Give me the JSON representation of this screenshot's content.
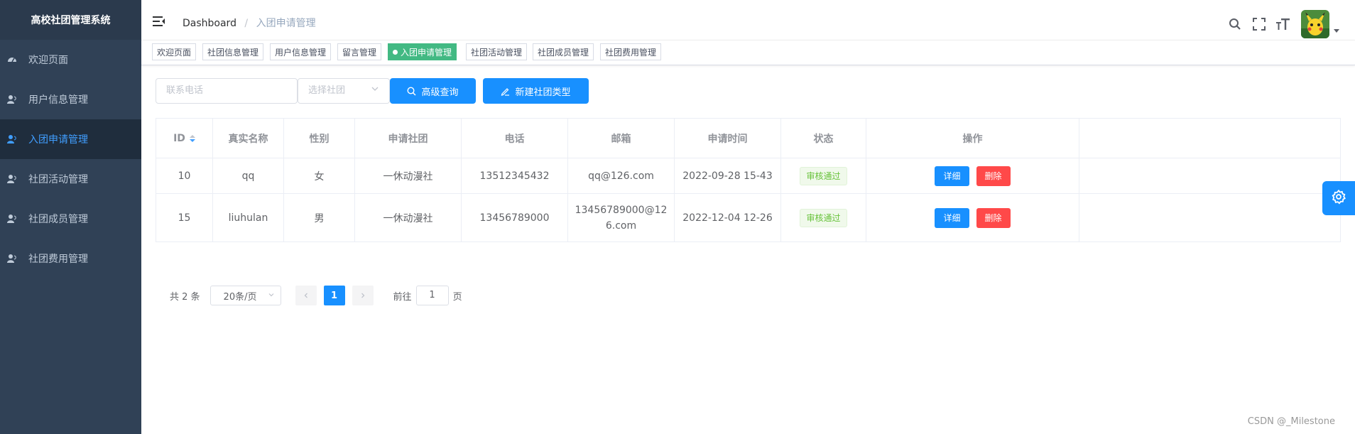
{
  "app": {
    "title": "高校社团管理系统"
  },
  "sidebar": {
    "items": [
      {
        "label": "欢迎页面",
        "icon": "dashboard-icon"
      },
      {
        "label": "用户信息管理",
        "icon": "user-icon"
      },
      {
        "label": "入团申请管理",
        "icon": "user-icon",
        "active": true
      },
      {
        "label": "社团活动管理",
        "icon": "user-icon"
      },
      {
        "label": "社团成员管理",
        "icon": "user-icon"
      },
      {
        "label": "社团费用管理",
        "icon": "user-icon"
      }
    ]
  },
  "navbar": {
    "breadcrumb": {
      "home": "Dashboard",
      "separator": "/",
      "current": "入团申请管理"
    },
    "tools": [
      "search-icon",
      "fullscreen-icon",
      "font-size-icon"
    ]
  },
  "tags": [
    {
      "label": "欢迎页面"
    },
    {
      "label": "社团信息管理"
    },
    {
      "label": "用户信息管理"
    },
    {
      "label": "留言管理"
    },
    {
      "label": "入团申请管理",
      "active": true
    },
    {
      "label": "社团活动管理"
    },
    {
      "label": "社团成员管理"
    },
    {
      "label": "社团费用管理"
    }
  ],
  "filters": {
    "phone_placeholder": "联系电话",
    "club_placeholder": "选择社团",
    "search_button": "高级查询",
    "create_button": "新建社团类型"
  },
  "table": {
    "headers": [
      "ID",
      "真实名称",
      "性别",
      "申请社团",
      "电话",
      "邮箱",
      "申请时间",
      "状态",
      "操作"
    ],
    "rows": [
      {
        "id": "10",
        "name": "qq",
        "gender": "女",
        "club": "一休动漫社",
        "phone": "13512345432",
        "email": "qq@126.com",
        "time": "2022-09-28 15-43",
        "status": "审核通过"
      },
      {
        "id": "15",
        "name": "liuhulan",
        "gender": "男",
        "club": "一休动漫社",
        "phone": "13456789000",
        "email": "13456789000@126.com",
        "time": "2022-12-04 12-26",
        "status": "审核通过"
      }
    ],
    "detail_label": "详细",
    "delete_label": "删除"
  },
  "pagination": {
    "total_text": "共 2 条",
    "page_size": "20条/页",
    "current_page": "1",
    "goto_label": "前往",
    "goto_value": "1",
    "page_suffix": "页"
  },
  "watermark": "CSDN @_Milestone",
  "colors": {
    "sidebar": "#304156",
    "primary": "#1890ff",
    "danger": "#ff4949",
    "success": "#42b983"
  }
}
